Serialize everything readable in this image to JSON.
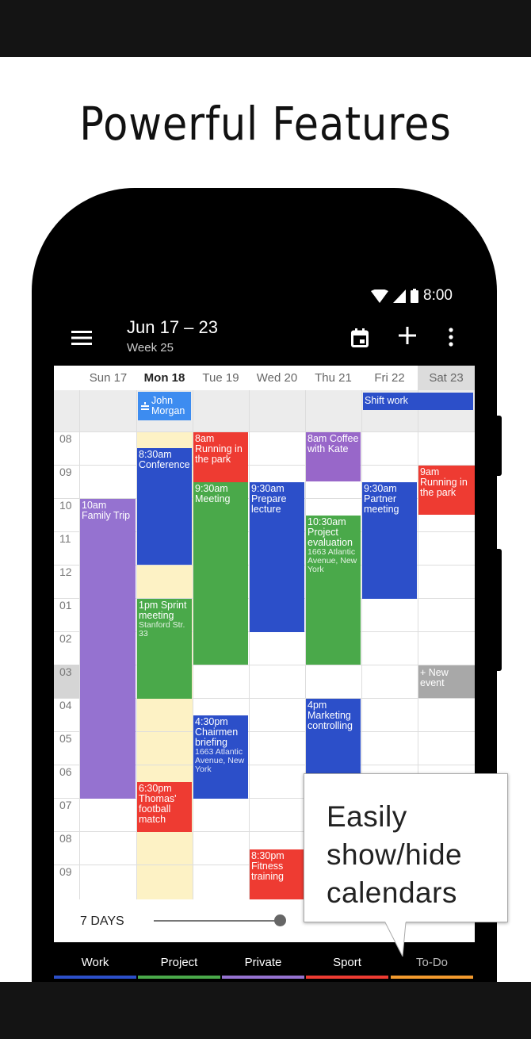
{
  "headline": "Powerful Features",
  "status_bar": {
    "time": "8:00"
  },
  "app_bar": {
    "title": "Jun 17 – 23",
    "subtitle": "Week 25"
  },
  "days": [
    "Sun 17",
    "Mon 18",
    "Tue 19",
    "Wed 20",
    "Thu 21",
    "Fri 22",
    "Sat 23"
  ],
  "hours": [
    "08",
    "09",
    "10",
    "11",
    "12",
    "01",
    "02",
    "03",
    "04",
    "05",
    "06",
    "07",
    "08",
    "09"
  ],
  "all_day_events": [
    {
      "title": "John Morgan",
      "icon": "cake-icon",
      "color": "#3d8cf0"
    },
    {
      "title": "Shift work",
      "color": "#2c4fc9"
    }
  ],
  "events": [
    {
      "day": "Sun 17",
      "time": "10am",
      "title": "Family Trip",
      "color": "#9572d0"
    },
    {
      "day": "Mon 18",
      "time": "8:30am",
      "title": "Conference",
      "color": "#2c4fc9"
    },
    {
      "day": "Mon 18",
      "time": "1pm",
      "title": "Sprint meeting",
      "location": "Stanford Str. 33",
      "color": "#4aa94a"
    },
    {
      "day": "Mon 18",
      "time": "6:30pm",
      "title": "Thomas' football match",
      "color": "#ee3b32"
    },
    {
      "day": "Tue 19",
      "time": "8am",
      "title": "Running in the park",
      "color": "#ee3b32"
    },
    {
      "day": "Tue 19",
      "time": "9:30am",
      "title": "Meeting",
      "color": "#4aa94a"
    },
    {
      "day": "Tue 19",
      "time": "4:30pm",
      "title": "Chairmen briefing",
      "location": "1663 Atlantic Avenue, New York",
      "color": "#2c4fc9"
    },
    {
      "day": "Wed 20",
      "time": "9:30am",
      "title": "Prepare lecture",
      "color": "#2c4fc9"
    },
    {
      "day": "Wed 20",
      "time": "8:30pm",
      "title": "Fitness training",
      "color": "#ee3b32"
    },
    {
      "day": "Thu 21",
      "time": "8am",
      "title": "Coffee with Kate",
      "color": "#9867c9"
    },
    {
      "day": "Thu 21",
      "time": "10:30am",
      "title": "Project evaluation",
      "location": "1663 Atlantic Avenue, New York",
      "color": "#4aa94a"
    },
    {
      "day": "Thu 21",
      "time": "4pm",
      "title": "Marketing controlling",
      "color": "#2c4fc9"
    },
    {
      "day": "Fri 22",
      "time": "9:30am",
      "title": "Partner meeting",
      "color": "#2c4fc9"
    },
    {
      "day": "Sat 23",
      "time": "9am",
      "title": "Running in the park",
      "color": "#ee3b32"
    },
    {
      "day": "Sat 23",
      "title": "+ New event",
      "color": "#a8a8a8"
    }
  ],
  "view_slider": {
    "label": "7 DAYS"
  },
  "calendars": [
    {
      "label": "Work",
      "color": "#2c4fc9"
    },
    {
      "label": "Project",
      "color": "#4aa94a"
    },
    {
      "label": "Private",
      "color": "#9572d0"
    },
    {
      "label": "Sport",
      "color": "#ee3b32"
    },
    {
      "label": "To-Do",
      "color": "#f29a2e"
    }
  ],
  "callout": {
    "line1": "Easily",
    "line2": "show/hide",
    "line3": "calendars"
  }
}
